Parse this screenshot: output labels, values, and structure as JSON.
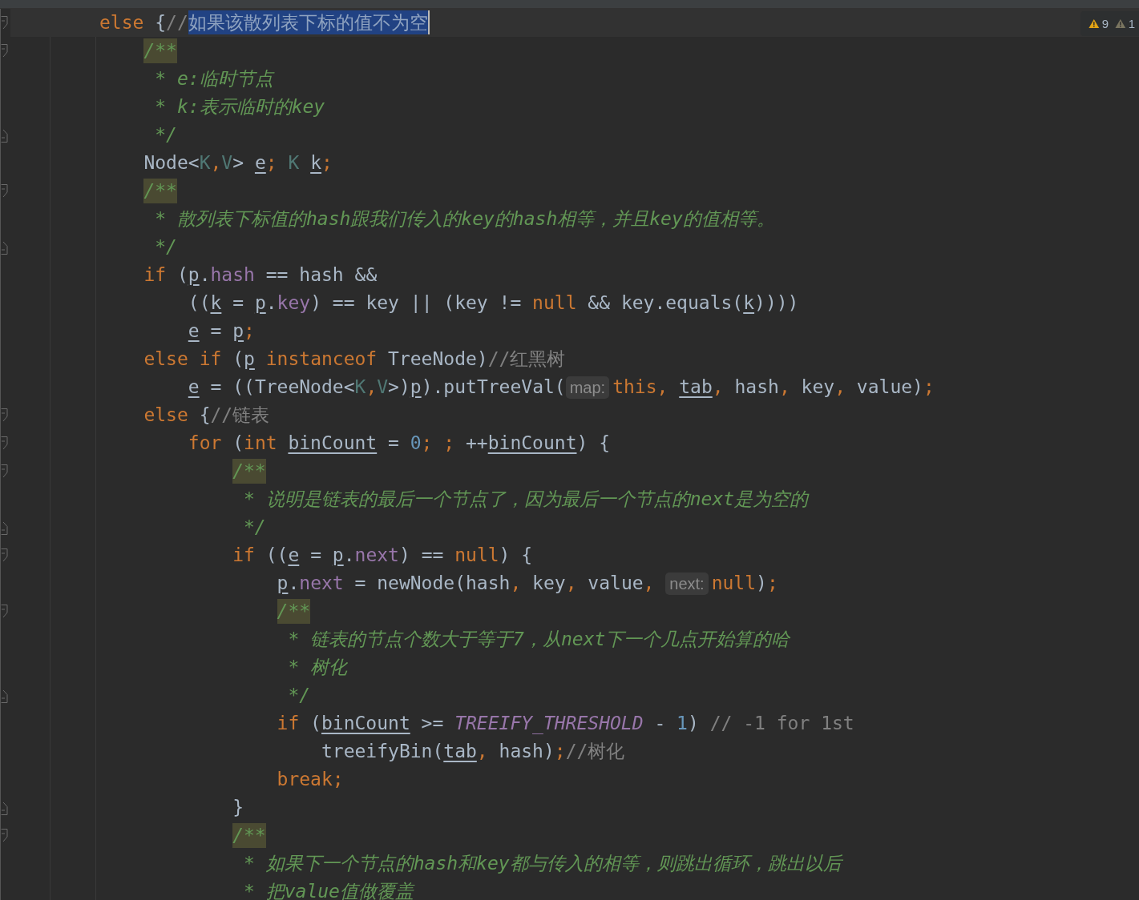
{
  "inspections": [
    {
      "kind": "warning",
      "count": "9"
    },
    {
      "kind": "weak",
      "count": "1"
    }
  ],
  "lines": [
    {
      "current": true,
      "fold_start": true,
      "tokens": [
        {
          "kind": "kw",
          "text": "else"
        },
        {
          "kind": "plain",
          "text": " {"
        },
        {
          "kind": "comment",
          "text": "//"
        },
        {
          "kind": "selected",
          "text": "如果该散列表下标的值不为空"
        }
      ]
    },
    {
      "fold_start": true,
      "tokens": [
        {
          "kind": "docstart",
          "text": "    /**"
        }
      ]
    },
    {
      "tokens": [
        {
          "kind": "doc",
          "text": "     * e:临时节点"
        }
      ]
    },
    {
      "tokens": [
        {
          "kind": "doc",
          "text": "     * k:表示临时的key"
        }
      ]
    },
    {
      "fold_end": true,
      "tokens": [
        {
          "kind": "doc",
          "text": "     */"
        }
      ]
    },
    {
      "tokens": [
        {
          "kind": "plain",
          "text": "    Node<"
        },
        {
          "kind": "tp",
          "text": "K"
        },
        {
          "kind": "kw",
          "text": ","
        },
        {
          "kind": "tp",
          "text": "V"
        },
        {
          "kind": "plain",
          "text": "> "
        },
        {
          "kind": "var",
          "text": "e"
        },
        {
          "kind": "kw",
          "text": "; "
        },
        {
          "kind": "tp",
          "text": "K "
        },
        {
          "kind": "var",
          "text": "k"
        },
        {
          "kind": "kw",
          "text": ";"
        }
      ]
    },
    {
      "fold_start": true,
      "tokens": [
        {
          "kind": "docstart",
          "text": "    /**"
        }
      ]
    },
    {
      "tokens": [
        {
          "kind": "doc",
          "text": "     * 散列表下标值的hash跟我们传入的key的hash相等，并且key的值相等。"
        }
      ]
    },
    {
      "fold_end": true,
      "tokens": [
        {
          "kind": "doc",
          "text": "     */"
        }
      ]
    },
    {
      "tokens": [
        {
          "kind": "kw",
          "text": "    if"
        },
        {
          "kind": "plain",
          "text": " ("
        },
        {
          "kind": "var",
          "text": "p"
        },
        {
          "kind": "plain",
          "text": "."
        },
        {
          "kind": "field",
          "text": "hash"
        },
        {
          "kind": "plain",
          "text": " == hash &&"
        }
      ]
    },
    {
      "tokens": [
        {
          "kind": "plain",
          "text": "        (("
        },
        {
          "kind": "var",
          "text": "k"
        },
        {
          "kind": "plain",
          "text": " = "
        },
        {
          "kind": "var",
          "text": "p"
        },
        {
          "kind": "plain",
          "text": "."
        },
        {
          "kind": "field",
          "text": "key"
        },
        {
          "kind": "plain",
          "text": ") == key || (key != "
        },
        {
          "kind": "kw",
          "text": "null"
        },
        {
          "kind": "plain",
          "text": " && key.equals("
        },
        {
          "kind": "var",
          "text": "k"
        },
        {
          "kind": "plain",
          "text": "))))"
        }
      ]
    },
    {
      "tokens": [
        {
          "kind": "var",
          "text": "        e"
        },
        {
          "kind": "plain",
          "text": " = "
        },
        {
          "kind": "var",
          "text": "p"
        },
        {
          "kind": "kw",
          "text": ";"
        }
      ]
    },
    {
      "tokens": [
        {
          "kind": "kw",
          "text": "    else if"
        },
        {
          "kind": "plain",
          "text": " ("
        },
        {
          "kind": "var",
          "text": "p"
        },
        {
          "kind": "kw",
          "text": " instanceof"
        },
        {
          "kind": "plain",
          "text": " TreeNode)"
        },
        {
          "kind": "comment",
          "text": "//红黑树"
        }
      ]
    },
    {
      "tokens": [
        {
          "kind": "var",
          "text": "        e"
        },
        {
          "kind": "plain",
          "text": " = ((TreeNode<"
        },
        {
          "kind": "tp",
          "text": "K"
        },
        {
          "kind": "kw",
          "text": ","
        },
        {
          "kind": "tp",
          "text": "V"
        },
        {
          "kind": "plain",
          "text": ">)"
        },
        {
          "kind": "var",
          "text": "p"
        },
        {
          "kind": "plain",
          "text": ").putTreeVal("
        },
        {
          "kind": "hint",
          "text": "map:"
        },
        {
          "kind": "kw",
          "text": "this, "
        },
        {
          "kind": "var",
          "text": "tab"
        },
        {
          "kind": "kw",
          "text": ","
        },
        {
          "kind": "plain",
          "text": " hash"
        },
        {
          "kind": "kw",
          "text": ","
        },
        {
          "kind": "plain",
          "text": " key"
        },
        {
          "kind": "kw",
          "text": ","
        },
        {
          "kind": "plain",
          "text": " value)"
        },
        {
          "kind": "kw",
          "text": ";"
        }
      ]
    },
    {
      "fold_start": true,
      "tokens": [
        {
          "kind": "kw",
          "text": "    else"
        },
        {
          "kind": "plain",
          "text": " {"
        },
        {
          "kind": "comment",
          "text": "//链表"
        }
      ]
    },
    {
      "fold_start": true,
      "tokens": [
        {
          "kind": "kw",
          "text": "        for"
        },
        {
          "kind": "plain",
          "text": " ("
        },
        {
          "kind": "kw",
          "text": "int "
        },
        {
          "kind": "var",
          "text": "binCount"
        },
        {
          "kind": "plain",
          "text": " = "
        },
        {
          "kind": "num",
          "text": "0"
        },
        {
          "kind": "kw",
          "text": "; ;"
        },
        {
          "kind": "plain",
          "text": " ++"
        },
        {
          "kind": "var",
          "text": "binCount"
        },
        {
          "kind": "plain",
          "text": ") {"
        }
      ]
    },
    {
      "fold_start": true,
      "tokens": [
        {
          "kind": "docstart",
          "text": "            /**"
        }
      ]
    },
    {
      "tokens": [
        {
          "kind": "doc",
          "text": "             * 说明是链表的最后一个节点了，因为最后一个节点的next是为空的"
        }
      ]
    },
    {
      "fold_end": true,
      "tokens": [
        {
          "kind": "doc",
          "text": "             */"
        }
      ]
    },
    {
      "fold_start": true,
      "tokens": [
        {
          "kind": "kw",
          "text": "            if"
        },
        {
          "kind": "plain",
          "text": " (("
        },
        {
          "kind": "var",
          "text": "e"
        },
        {
          "kind": "plain",
          "text": " = "
        },
        {
          "kind": "var",
          "text": "p"
        },
        {
          "kind": "plain",
          "text": "."
        },
        {
          "kind": "field",
          "text": "next"
        },
        {
          "kind": "plain",
          "text": ") == "
        },
        {
          "kind": "kw",
          "text": "null"
        },
        {
          "kind": "plain",
          "text": ") {"
        }
      ]
    },
    {
      "tokens": [
        {
          "kind": "var",
          "text": "                p"
        },
        {
          "kind": "plain",
          "text": "."
        },
        {
          "kind": "field",
          "text": "next"
        },
        {
          "kind": "plain",
          "text": " = newNode(hash"
        },
        {
          "kind": "kw",
          "text": ","
        },
        {
          "kind": "plain",
          "text": " key"
        },
        {
          "kind": "kw",
          "text": ","
        },
        {
          "kind": "plain",
          "text": " value"
        },
        {
          "kind": "kw",
          "text": ", "
        },
        {
          "kind": "hint",
          "text": "next:"
        },
        {
          "kind": "kw",
          "text": "null"
        },
        {
          "kind": "plain",
          "text": ")"
        },
        {
          "kind": "kw",
          "text": ";"
        }
      ]
    },
    {
      "fold_start": true,
      "tokens": [
        {
          "kind": "docstart",
          "text": "                /**"
        }
      ]
    },
    {
      "tokens": [
        {
          "kind": "doc",
          "text": "                 * 链表的节点个数大于等于7，从next下一个几点开始算的哈"
        }
      ]
    },
    {
      "tokens": [
        {
          "kind": "doc",
          "text": "                 * 树化"
        }
      ]
    },
    {
      "fold_end": true,
      "tokens": [
        {
          "kind": "doc",
          "text": "                 */"
        }
      ]
    },
    {
      "tokens": [
        {
          "kind": "kw",
          "text": "                if"
        },
        {
          "kind": "plain",
          "text": " ("
        },
        {
          "kind": "var",
          "text": "binCount"
        },
        {
          "kind": "plain",
          "text": " >= "
        },
        {
          "kind": "const",
          "text": "TREEIFY_THRESHOLD"
        },
        {
          "kind": "plain",
          "text": " - "
        },
        {
          "kind": "num",
          "text": "1"
        },
        {
          "kind": "plain",
          "text": ") "
        },
        {
          "kind": "comment",
          "text": "// -1 for 1st"
        }
      ]
    },
    {
      "tokens": [
        {
          "kind": "plain",
          "text": "                    treeifyBin("
        },
        {
          "kind": "var",
          "text": "tab"
        },
        {
          "kind": "kw",
          "text": ","
        },
        {
          "kind": "plain",
          "text": " hash)"
        },
        {
          "kind": "kw",
          "text": ";"
        },
        {
          "kind": "comment",
          "text": "//树化"
        }
      ]
    },
    {
      "tokens": [
        {
          "kind": "kw",
          "text": "                break;"
        }
      ]
    },
    {
      "fold_end": true,
      "tokens": [
        {
          "kind": "plain",
          "text": "            }"
        }
      ]
    },
    {
      "fold_start": true,
      "tokens": [
        {
          "kind": "docstart",
          "text": "            /**"
        }
      ]
    },
    {
      "tokens": [
        {
          "kind": "doc",
          "text": "             * 如果下一个节点的hash和key都与传入的相等，则跳出循环，跳出以后"
        }
      ]
    },
    {
      "tokens": [
        {
          "kind": "doc",
          "text": "             * 把value值做覆盖"
        }
      ]
    }
  ]
}
